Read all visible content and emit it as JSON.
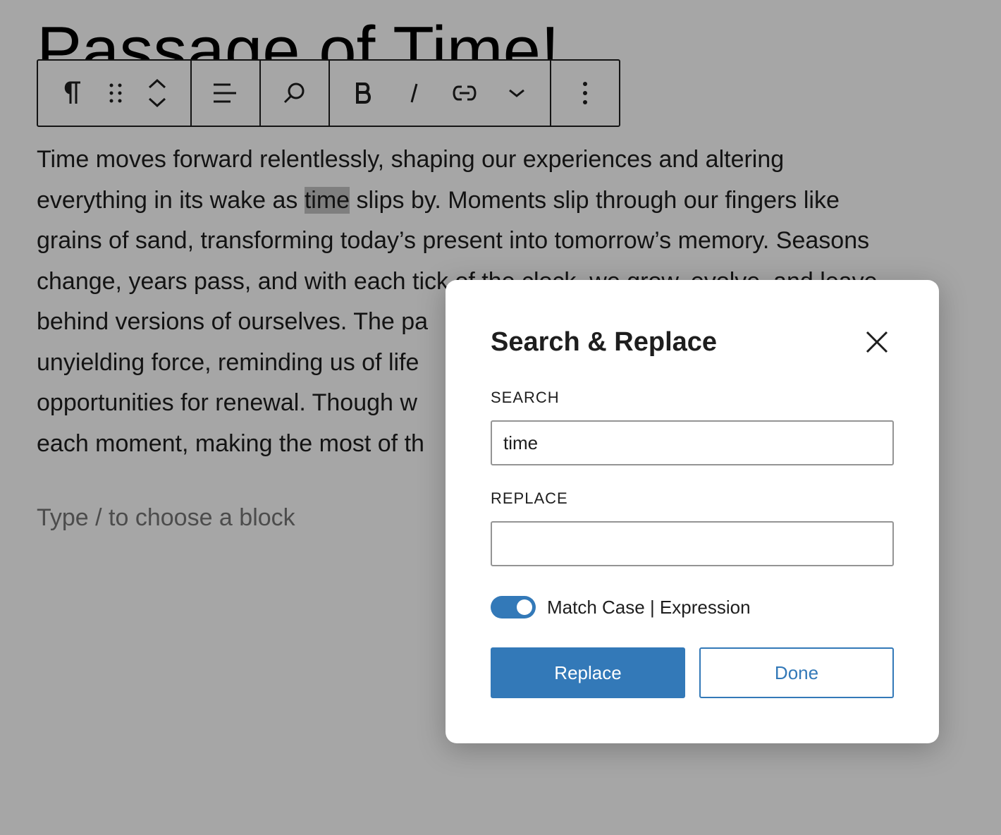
{
  "editor": {
    "post_title": "Passage of Time!",
    "paragraph_lines": [
      {
        "text": "Time moves forward relentlessly, shaping our experiences and altering"
      },
      {
        "before": "everything in its wake as ",
        "highlight": "time",
        "after": " slips by. Moments slip through our fingers like"
      },
      {
        "text": "grains of sand, transforming today’s present into tomorrow’s memory. Seasons"
      },
      {
        "text": "change, years pass, and with each tick of the clock, we grow, evolve, and leave"
      },
      {
        "text": "behind versions of ourselves. The pa"
      },
      {
        "text": "unyielding force, reminding us of life"
      },
      {
        "text": "opportunities for renewal. Though w"
      },
      {
        "text": "each moment, making the most of th"
      }
    ],
    "block_placeholder": "Type / to choose a block"
  },
  "toolbar": {
    "icons": [
      "paragraph-icon",
      "drag-handle-icon",
      "move-up-icon",
      "move-down-icon",
      "align-left-icon",
      "search-icon",
      "bold-icon",
      "italic-icon",
      "link-icon",
      "chevron-down-icon",
      "more-options-icon"
    ]
  },
  "modal": {
    "title": "Search & Replace",
    "search_label": "SEARCH",
    "search_value": "time",
    "replace_label": "REPLACE",
    "replace_value": "",
    "toggle_label": "Match Case | Expression",
    "toggle_on": true,
    "replace_button": "Replace",
    "done_button": "Done"
  },
  "colors": {
    "accent": "#3379b8",
    "overlay": "rgba(0,0,0,0.35)",
    "text": "#1e1e1e",
    "placeholder": "#757575"
  }
}
